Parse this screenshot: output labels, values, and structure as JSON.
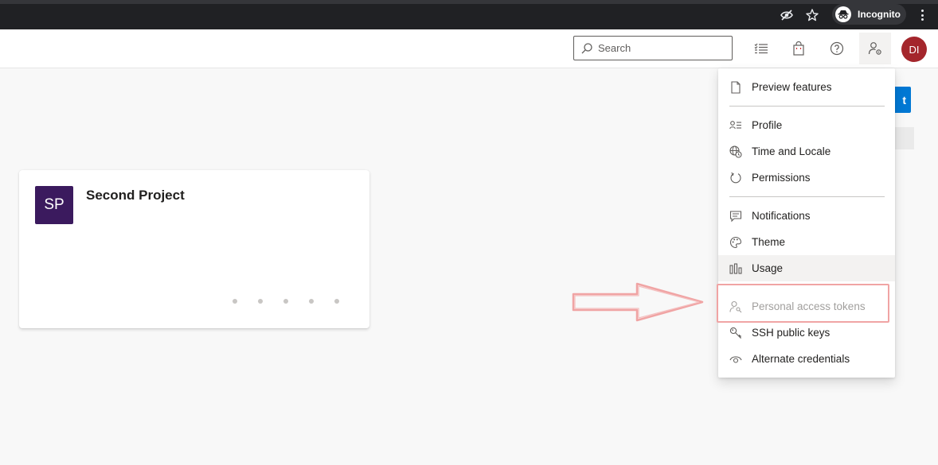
{
  "browser": {
    "incognito_label": "Incognito"
  },
  "header": {
    "search": {
      "placeholder": "Search"
    },
    "avatar_initials": "DI"
  },
  "page": {
    "new_project_label": "t",
    "project": {
      "initials": "SP",
      "name": "Second Project"
    }
  },
  "user_menu": {
    "items": [
      {
        "label": "Preview features",
        "icon": "document-icon"
      },
      {
        "label": "Profile",
        "icon": "contact-card-icon"
      },
      {
        "label": "Time and Locale",
        "icon": "globe-clock-icon"
      },
      {
        "label": "Permissions",
        "icon": "refresh-icon"
      },
      {
        "label": "Notifications",
        "icon": "message-icon"
      },
      {
        "label": "Theme",
        "icon": "palette-icon"
      },
      {
        "label": "Usage",
        "icon": "bar-chart-icon"
      },
      {
        "label": "Personal access tokens",
        "icon": "user-key-icon"
      },
      {
        "label": "SSH public keys",
        "icon": "key-icon"
      },
      {
        "label": "Alternate credentials",
        "icon": "eye-icon"
      }
    ]
  },
  "colors": {
    "accent": "#0078d4",
    "avatar": "#a4262c",
    "project_tile": "#3b1a5e",
    "annotation": "#f0a4a4"
  }
}
